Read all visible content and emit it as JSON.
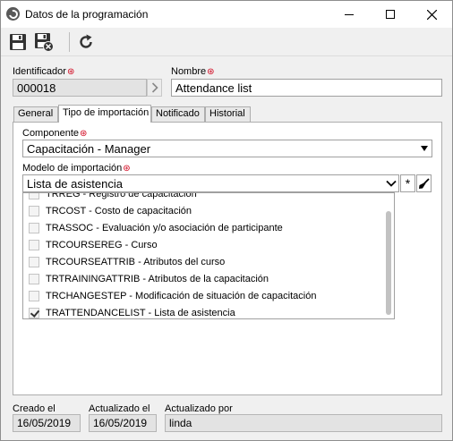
{
  "window": {
    "title": "Datos de la programación",
    "minimize_icon": "minimize-icon",
    "maximize_icon": "maximize-icon",
    "close_icon": "close-icon"
  },
  "toolbar": {
    "save_icon": "save-icon",
    "save_close_icon": "save-and-close-icon",
    "refresh_icon": "refresh-icon"
  },
  "header": {
    "identifier_label": "Identificador",
    "identifier_value": "000018",
    "name_label": "Nombre",
    "name_value": "Attendance list",
    "required_marker": "⊛"
  },
  "tabs": [
    {
      "label": "General",
      "active": false
    },
    {
      "label": "Tipo de importación",
      "active": true
    },
    {
      "label": "Notificado",
      "active": false
    },
    {
      "label": "Historial",
      "active": false
    }
  ],
  "import": {
    "component_label": "Componente",
    "component_value": "Capacitación - Manager",
    "model_label": "Modelo de importación",
    "model_value": "Lista de asistencia",
    "options": [
      {
        "label": "TRREG - Registro de capacitación",
        "checked": false,
        "partial": true
      },
      {
        "label": "TRCOST - Costo de capacitación",
        "checked": false
      },
      {
        "label": "TRASSOC - Evaluación y/o asociación de participante",
        "checked": false
      },
      {
        "label": "TRCOURSEREG - Curso",
        "checked": false
      },
      {
        "label": "TRCOURSEATTRIB - Atributos del curso",
        "checked": false
      },
      {
        "label": "TRTRAININGATTRIB - Atributos de la capacitación",
        "checked": false
      },
      {
        "label": "TRCHANGESTEP - Modificación de situación de capacitación",
        "checked": false
      },
      {
        "label": "TRATTENDANCELIST - Lista de asistencia",
        "checked": true
      }
    ]
  },
  "footer": {
    "created_label": "Creado el",
    "created_value": "16/05/2019",
    "updated_label": "Actualizado el",
    "updated_value": "16/05/2019",
    "updated_by_label": "Actualizado por",
    "updated_by_value": "linda"
  },
  "colors": {
    "required": "#d0021b",
    "readonly_bg": "#e3e3e3",
    "window_bg": "#f0f0f0"
  }
}
